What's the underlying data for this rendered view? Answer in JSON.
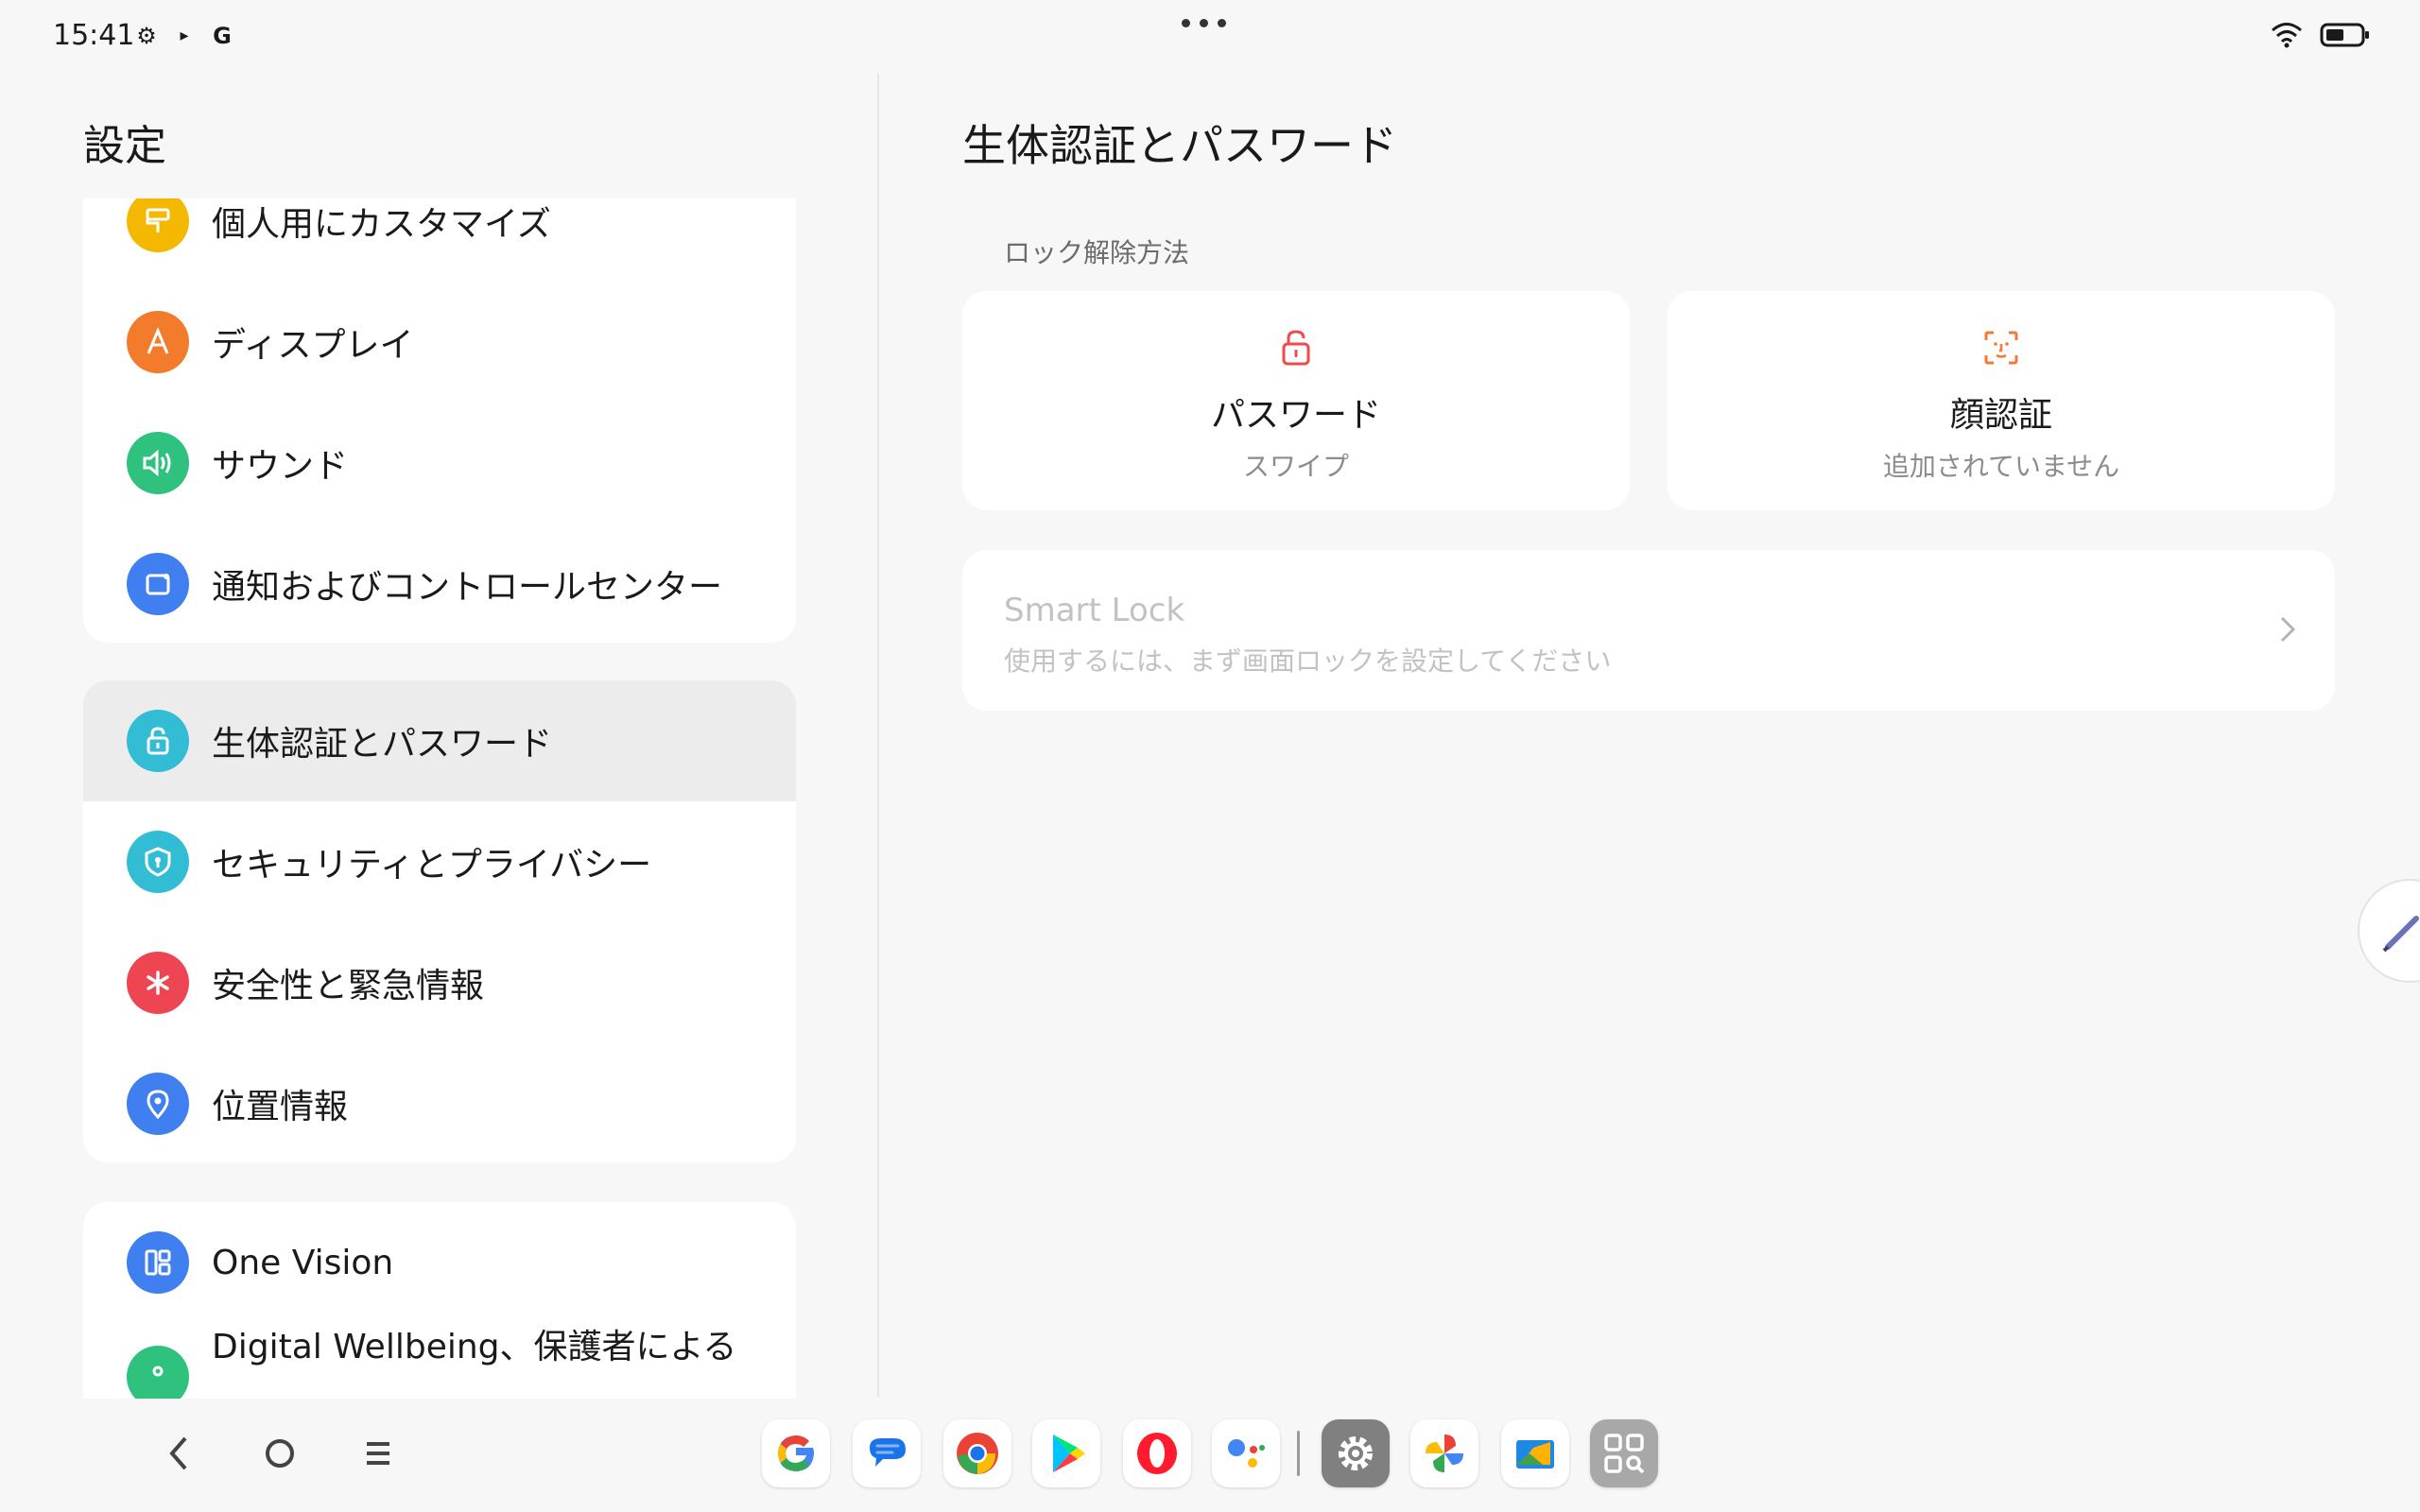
{
  "status_bar": {
    "time": "15:41",
    "icons_left": [
      "gear-icon",
      "battery-saver-icon",
      "google-icon"
    ],
    "icons_right": [
      "wifi-icon",
      "battery-icon"
    ]
  },
  "left_panel": {
    "title": "設定",
    "groups": [
      {
        "items": [
          {
            "label": "個人用にカスタマイズ",
            "icon": "paint-roller-icon",
            "color": "#f5b800"
          },
          {
            "label": "ディスプレイ",
            "icon": "display-a-icon",
            "color": "#f37b2c"
          },
          {
            "label": "サウンド",
            "icon": "speaker-icon",
            "color": "#2ec27e"
          },
          {
            "label": "通知およびコントロールセンター",
            "icon": "notification-icon",
            "color": "#3f7ff0"
          }
        ]
      },
      {
        "items": [
          {
            "label": "生体認証とパスワード",
            "icon": "lock-icon",
            "color": "#32bdd4",
            "selected": true
          },
          {
            "label": "セキュリティとプライバシー",
            "icon": "shield-icon",
            "color": "#32bdd4"
          },
          {
            "label": "安全性と緊急情報",
            "icon": "asterisk-icon",
            "color": "#ee4552"
          },
          {
            "label": "位置情報",
            "icon": "location-pin-icon",
            "color": "#3f7ff0"
          }
        ]
      },
      {
        "items": [
          {
            "label": "One Vision",
            "icon": "layout-icon",
            "color": "#3f7ff0"
          },
          {
            "label": "Digital Wellbeing、保護者による",
            "icon": "wellbeing-icon",
            "color": "#2ec27e"
          }
        ]
      }
    ]
  },
  "right_panel": {
    "title": "生体認証とパスワード",
    "section_label": "ロック解除方法",
    "unlock_methods": [
      {
        "title": "パスワード",
        "subtitle": "スワイプ",
        "icon": "lock-icon",
        "color": "#f04a4a"
      },
      {
        "title": "顔認証",
        "subtitle": "追加されていません",
        "icon": "face-scan-icon",
        "color": "#f27a34"
      }
    ],
    "smart_lock": {
      "title": "Smart Lock",
      "subtitle": "使用するには、まず画面ロックを設定してください"
    }
  },
  "nav_bar": {
    "buttons": [
      "back-icon",
      "home-icon",
      "recents-icon"
    ],
    "dock_apps": [
      "google-app",
      "messages-app",
      "chrome-app",
      "play-store-app",
      "opera-app",
      "assistant-app",
      "settings-app",
      "photos-app",
      "files-app",
      "app-library"
    ]
  }
}
